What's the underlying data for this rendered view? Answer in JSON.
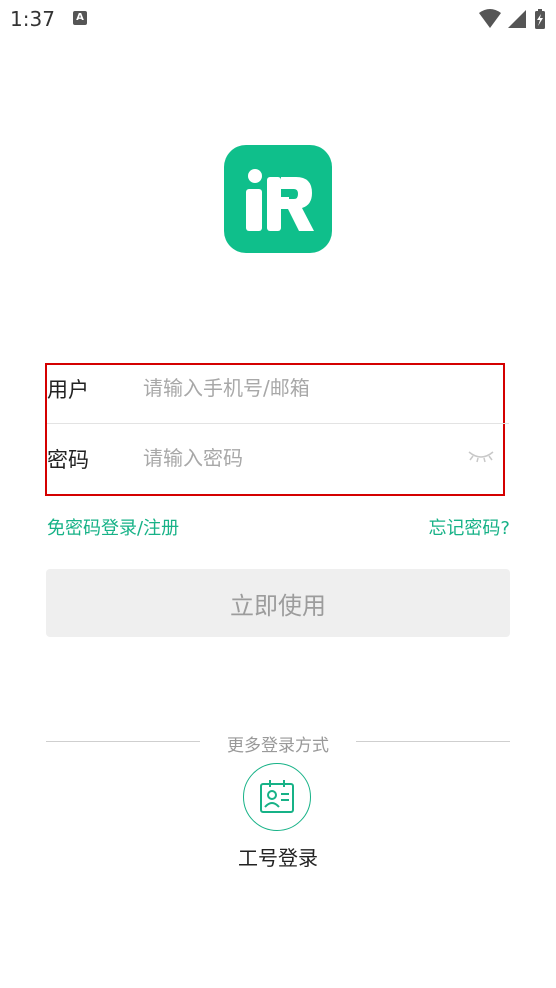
{
  "status_bar": {
    "time": "1:37",
    "notification_icon_letter": "A"
  },
  "login_form": {
    "username_label": "用户",
    "username_placeholder": "请输入手机号/邮箱",
    "password_label": "密码",
    "password_placeholder": "请输入密码"
  },
  "links": {
    "sms_login_register": "免密码登录/注册",
    "forgot_password": "忘记密码?"
  },
  "submit_label": "立即使用",
  "more_login": {
    "title": "更多登录方式",
    "employee_id_login": "工号登录"
  },
  "colors": {
    "brand": "#0fbf8b",
    "link": "#17b287",
    "highlight_border": "#d40000"
  }
}
